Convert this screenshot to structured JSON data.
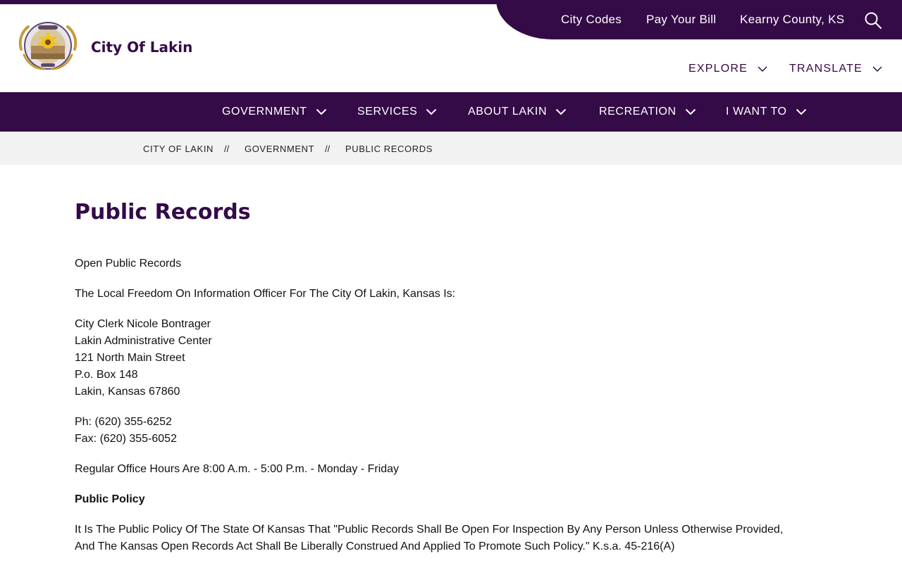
{
  "site": {
    "name": "City Of Lakin",
    "logo_alt": "City of Lakin seal"
  },
  "utility_nav": {
    "links": [
      "City Codes",
      "Pay Your Bill",
      "Kearny County, KS"
    ],
    "search_icon": "search-icon"
  },
  "secondary_nav": {
    "explore": "EXPLORE",
    "translate": "TRANSLATE"
  },
  "main_nav": {
    "items": [
      "GOVERNMENT",
      "SERVICES",
      "ABOUT LAKIN",
      "RECREATION",
      "I WANT TO"
    ]
  },
  "breadcrumb": {
    "items": [
      "CITY OF LAKIN",
      "GOVERNMENT",
      "PUBLIC RECORDS"
    ],
    "separator": "//"
  },
  "page": {
    "title": "Public Records",
    "intro": "Open Public Records",
    "officer_heading": "The Local Freedom On Information Officer For The City Of Lakin, Kansas Is:",
    "address_lines": [
      "City Clerk Nicole Bontrager",
      "Lakin Administrative Center",
      "121 North Main Street",
      "P.o. Box 148",
      "Lakin, Kansas 67860"
    ],
    "phone": "Ph: (620) 355-6252",
    "fax": "Fax: (620) 355-6052",
    "hours": "Regular Office Hours Are 8:00 A.m. - 5:00 P.m. - Monday - Friday",
    "policy_heading": "Public Policy",
    "policy_text_1": "It Is The Public Policy Of The State Of Kansas That \"Public Records Shall Be Open For Inspection By Any Person Unless Otherwise Provided,",
    "policy_text_2": "And The Kansas Open Records Act Shall Be Liberally Construed And Applied To Promote Such Policy.\"  K.s.a. 45-216(A)"
  },
  "colors": {
    "brand_purple": "#340a47",
    "breadcrumb_bg": "#f2f2f2",
    "text": "#111111"
  }
}
